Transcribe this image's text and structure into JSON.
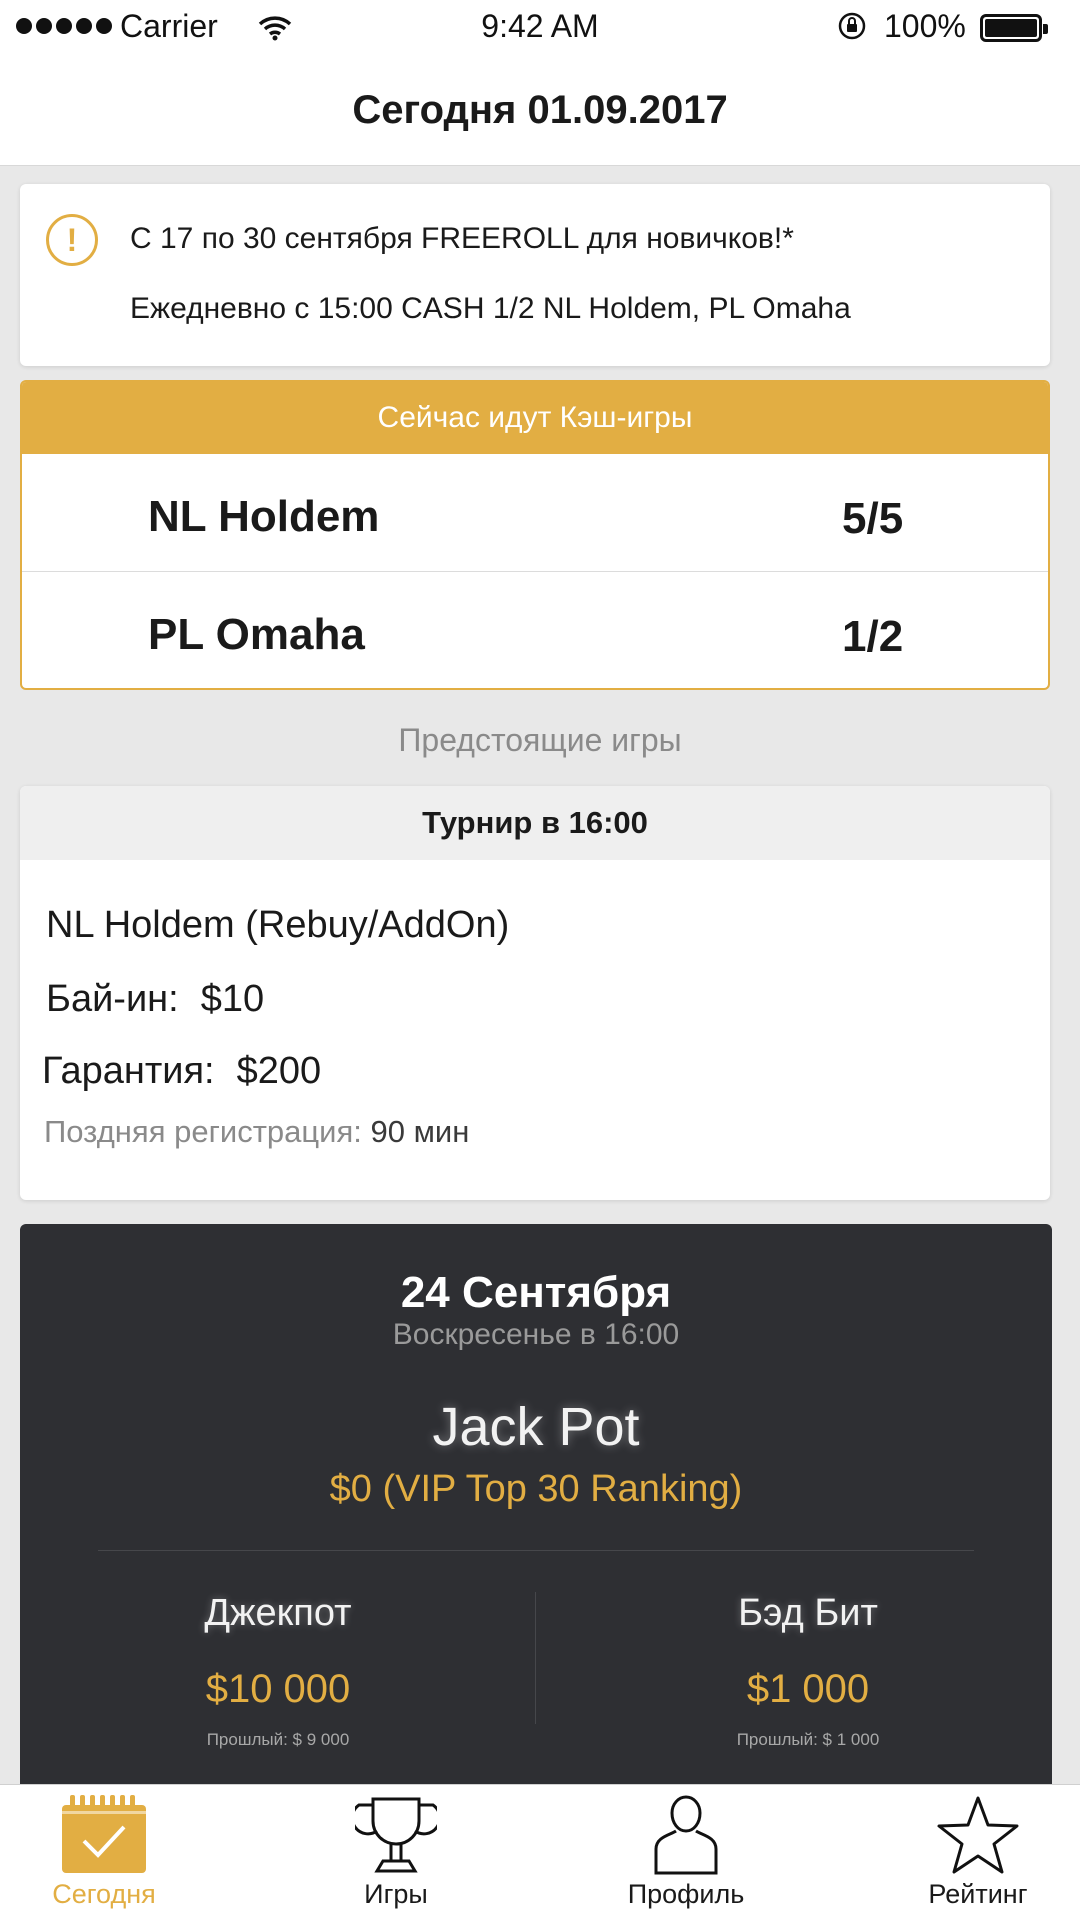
{
  "status_bar": {
    "carrier": "Carrier",
    "time": "9:42 AM",
    "battery": "100%"
  },
  "nav": {
    "title": "Сегодня 01.09.2017"
  },
  "info": {
    "icon": "alert-icon",
    "line1": "С 17 по 30 сентября FREEROLL для новичков!*",
    "line2": "Ежедневно с 15:00 CASH 1/2 NL Holdem, PL Omaha"
  },
  "cash_games": {
    "header": "Сейчас идут Кэш-игры",
    "rows": [
      {
        "name": "NL Holdem",
        "limit": "5/5"
      },
      {
        "name": "PL Omaha",
        "limit": "1/2"
      }
    ]
  },
  "upcoming": {
    "label": "Предстоящие игры"
  },
  "tournament": {
    "header": "Турнир в 16:00",
    "game": "NL Holdem (Rebuy/AddOn)",
    "buyin_label": "Бай-ин:",
    "buyin_value": "$10",
    "guarantee_label": "Гарантия:",
    "guarantee_value": "$200",
    "late_reg_label": "Поздняя регистрация:",
    "late_reg_value": "90 мин"
  },
  "jackpot": {
    "date": "24 Сентября",
    "subtitle": "Воскресенье в 16:00",
    "title": "Jack Pot",
    "prize": "$0 (VIP Top 30 Ranking)",
    "left": {
      "label": "Джекпот",
      "amount": "$10 000",
      "previous": "Прошлый:  $ 9 000"
    },
    "right": {
      "label": "Бэд Бит",
      "amount": "$1 000",
      "previous": "Прошлый:  $ 1 000"
    }
  },
  "tabs": [
    {
      "label": "Сегодня",
      "icon": "calendar-check-icon",
      "active": true
    },
    {
      "label": "Игры",
      "icon": "trophy-icon",
      "active": false
    },
    {
      "label": "Профиль",
      "icon": "person-icon",
      "active": false
    },
    {
      "label": "Рейтинг",
      "icon": "star-icon",
      "active": false
    }
  ],
  "colors": {
    "accent": "#e2ae43",
    "dark_card": "#2e2f33",
    "background": "#e8e8e8"
  }
}
